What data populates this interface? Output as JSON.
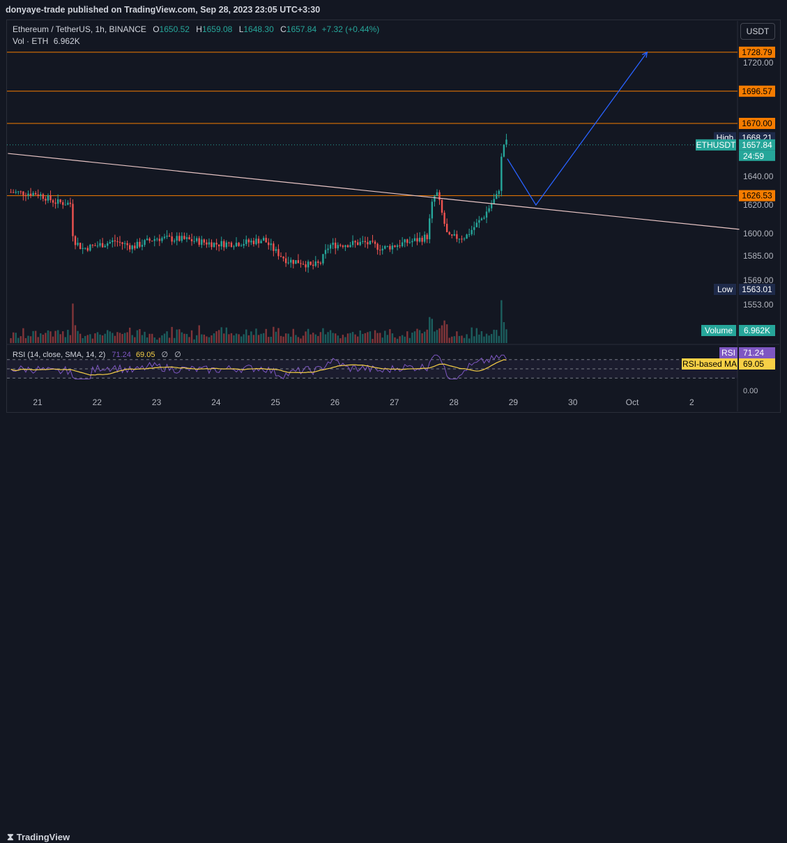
{
  "header": {
    "published_text": "donyaye-trade published on TradingView.com, Sep 28, 2023 23:05 UTC+3:30"
  },
  "legend": {
    "symbol": "Ethereum / TetherUS, 1h, BINANCE",
    "open_label": "O",
    "open": "1650.52",
    "high_label": "H",
    "high": "1659.08",
    "low_label": "L",
    "low": "1648.30",
    "close_label": "C",
    "close": "1657.84",
    "change": "+7.32 (+0.44%)",
    "vol_label": "Vol · ETH",
    "vol_value": "6.962K"
  },
  "rsi_legend": {
    "label": "RSI (14, close, SMA, 14, 2)",
    "rsi": "71.24",
    "ma": "69.05",
    "extra1": "∅",
    "extra2": "∅"
  },
  "currency_button": "USDT",
  "footer": {
    "brand": "TradingView"
  },
  "colors": {
    "background": "#131722",
    "up": "#26a69a",
    "down": "#ef5350",
    "level_line": "#f57c00",
    "projection": "#2962ff",
    "trendline": "#e8c5c5",
    "rsi_line": "#7e57c2",
    "rsi_ma": "#f7d046"
  },
  "chart_data": {
    "type": "candlestick",
    "symbol": "ETHUSDT",
    "timeframe": "1h",
    "x_ticks": [
      "21",
      "22",
      "23",
      "24",
      "25",
      "26",
      "27",
      "28",
      "29",
      "30",
      "Oct",
      "2"
    ],
    "x_tick_days": [
      0,
      1,
      2,
      3,
      4,
      5,
      6,
      7,
      8,
      9,
      10,
      11
    ],
    "y_ticks": [
      {
        "label": "1720.00",
        "price": 1720
      },
      {
        "label": "1640.00",
        "price": 1640
      },
      {
        "label": "1620.00",
        "price": 1620
      },
      {
        "label": "1600.00",
        "price": 1600
      },
      {
        "label": "1585.00",
        "price": 1585
      },
      {
        "label": "1569.00",
        "price": 1569
      },
      {
        "label": "1553.00",
        "price": 1553
      }
    ],
    "price_range": [
      1530,
      1745
    ],
    "levels": [
      {
        "label": "1728.79",
        "price": 1728.79
      },
      {
        "label": "1696.57",
        "price": 1696.57
      },
      {
        "label": "1670.00",
        "price": 1670.0
      },
      {
        "label": "1626.53",
        "price": 1626.53
      }
    ],
    "high": {
      "label": "High",
      "value": "1668.21",
      "price": 1668.21
    },
    "low": {
      "label": "Low",
      "value": "1563.01",
      "price": 1563.01
    },
    "last": {
      "label": "ETHUSDT",
      "value": "1657.84",
      "price": 1657.84,
      "countdown": "24:59"
    },
    "volume_badge": {
      "label": "Volume",
      "value": "6.962K"
    },
    "trendline": [
      {
        "day": -0.5,
        "price": 1653
      },
      {
        "day": 11.8,
        "price": 1603
      }
    ],
    "projection": [
      {
        "day": 7.9,
        "price": 1650
      },
      {
        "day": 8.38,
        "price": 1620
      },
      {
        "day": 10.25,
        "price": 1728.79
      }
    ],
    "daily_path": [
      {
        "day": -0.45,
        "price": 1629
      },
      {
        "day": 0.0,
        "price": 1628
      },
      {
        "day": 0.3,
        "price": 1622
      },
      {
        "day": 0.55,
        "price": 1621
      },
      {
        "day": 0.6,
        "price": 1596
      },
      {
        "day": 0.75,
        "price": 1590
      },
      {
        "day": 1.0,
        "price": 1592
      },
      {
        "day": 1.3,
        "price": 1595
      },
      {
        "day": 1.6,
        "price": 1591
      },
      {
        "day": 2.0,
        "price": 1597
      },
      {
        "day": 2.5,
        "price": 1596
      },
      {
        "day": 3.0,
        "price": 1593
      },
      {
        "day": 3.5,
        "price": 1594
      },
      {
        "day": 3.8,
        "price": 1596
      },
      {
        "day": 4.0,
        "price": 1588
      },
      {
        "day": 4.2,
        "price": 1582
      },
      {
        "day": 4.45,
        "price": 1581
      },
      {
        "day": 4.6,
        "price": 1578
      },
      {
        "day": 4.75,
        "price": 1580
      },
      {
        "day": 4.9,
        "price": 1592
      },
      {
        "day": 5.2,
        "price": 1593
      },
      {
        "day": 5.5,
        "price": 1594
      },
      {
        "day": 5.8,
        "price": 1590
      },
      {
        "day": 6.0,
        "price": 1592
      },
      {
        "day": 6.4,
        "price": 1596
      },
      {
        "day": 6.55,
        "price": 1598
      },
      {
        "day": 6.65,
        "price": 1625
      },
      {
        "day": 6.72,
        "price": 1628
      },
      {
        "day": 6.8,
        "price": 1614
      },
      {
        "day": 6.9,
        "price": 1597
      },
      {
        "day": 7.2,
        "price": 1598
      },
      {
        "day": 7.5,
        "price": 1612
      },
      {
        "day": 7.65,
        "price": 1622
      },
      {
        "day": 7.75,
        "price": 1628
      },
      {
        "day": 7.8,
        "price": 1650
      },
      {
        "day": 7.85,
        "price": 1660
      },
      {
        "day": 7.92,
        "price": 1657.84
      }
    ],
    "rsi": {
      "value": 71.24,
      "ma": 69.05,
      "upper": 70,
      "lower": 30,
      "range": [
        0,
        100
      ]
    }
  }
}
